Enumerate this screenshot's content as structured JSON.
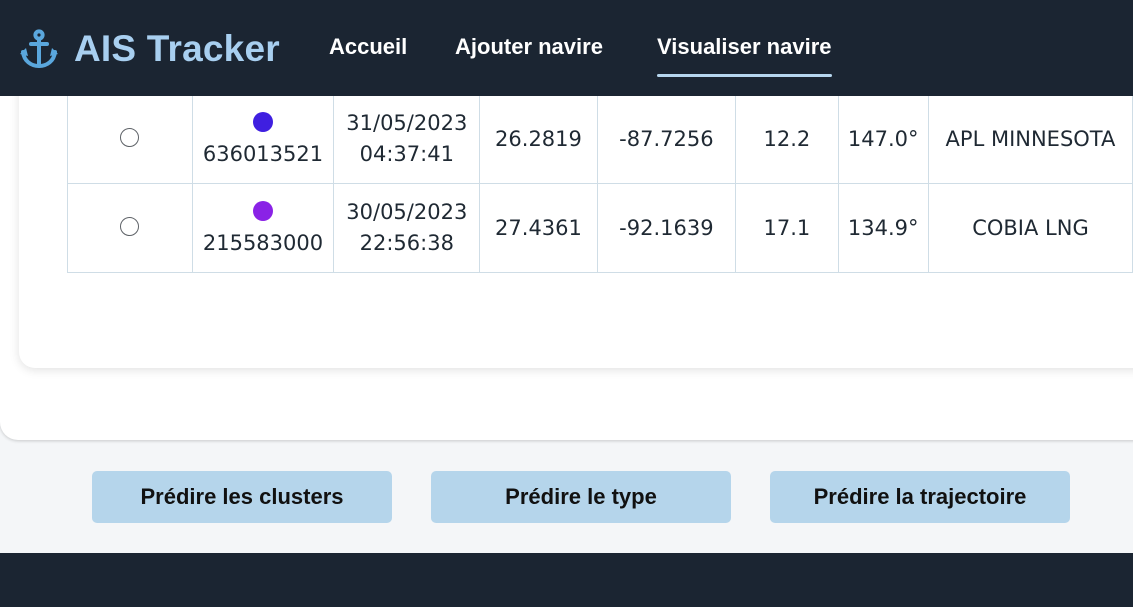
{
  "app": {
    "title": "AIS Tracker",
    "brand_icon": "anchor-icon",
    "brand_color": "#a8cff0",
    "header_bg": "#1b2532"
  },
  "nav": {
    "home": "Accueil",
    "add_vessel": "Ajouter navire",
    "view_vessel": "Visualiser navire",
    "active": "Visualiser navire"
  },
  "table": {
    "rows": [
      {
        "selected": false,
        "color": "#3f1fe0",
        "mmsi": "636013521",
        "date": "31/05/2023",
        "time": "04:37:41",
        "lat": "26.2819",
        "lon": "-87.7256",
        "sog": "12.2",
        "heading": "147.0°",
        "name": "APL MINNESOTA"
      },
      {
        "selected": false,
        "color": "#8a22e6",
        "mmsi": "215583000",
        "date": "30/05/2023",
        "time": "22:56:38",
        "lat": "27.4361",
        "lon": "-92.1639",
        "sog": "17.1",
        "heading": "134.9°",
        "name": "COBIA LNG"
      }
    ]
  },
  "actions": {
    "clusters": "Prédire les clusters",
    "type": "Prédire le type",
    "trajectory": "Prédire la trajectoire",
    "button_color": "#b5d5eb"
  }
}
